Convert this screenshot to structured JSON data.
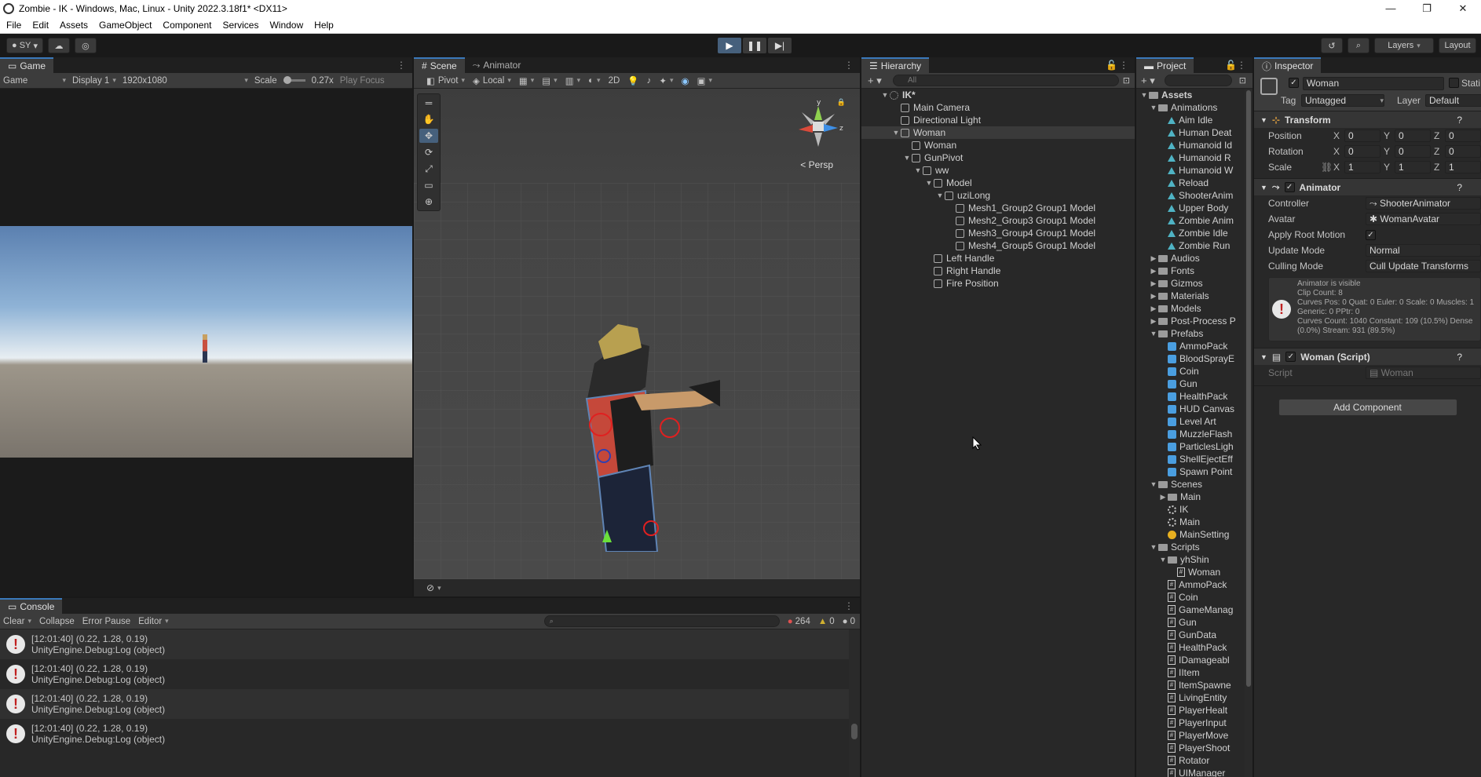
{
  "window": {
    "title": "Zombie - IK - Windows, Mac, Linux - Unity 2022.3.18f1* <DX11>",
    "minimize": "—",
    "maximize": "❐",
    "close": "✕"
  },
  "menu": [
    "File",
    "Edit",
    "Assets",
    "GameObject",
    "Component",
    "Services",
    "Window",
    "Help"
  ],
  "toolbar": {
    "account": "SY",
    "layers": "Layers",
    "layout": "Layout"
  },
  "game": {
    "tab": "Game",
    "mode": "Game",
    "display": "Display 1",
    "resolution": "1920x1080",
    "scale_label": "Scale",
    "scale_value": "0.27x",
    "play_focus": "Play Focus"
  },
  "scene": {
    "tab_scene": "Scene",
    "tab_animator": "Animator",
    "pivot": "Pivot",
    "local": "Local",
    "mode_2d": "2D",
    "persp": "Persp",
    "axis_y": "y",
    "axis_z": "z"
  },
  "hierarchy": {
    "tab": "Hierarchy",
    "search_placeholder": "All",
    "rows": [
      {
        "label": "IK*",
        "depth": 0,
        "arrow": "▼",
        "kind": "scene"
      },
      {
        "label": "Main Camera",
        "depth": 1,
        "arrow": "",
        "kind": "go"
      },
      {
        "label": "Directional Light",
        "depth": 1,
        "arrow": "",
        "kind": "go"
      },
      {
        "label": "Woman",
        "depth": 1,
        "arrow": "▼",
        "kind": "go",
        "selected": true
      },
      {
        "label": "Woman",
        "depth": 2,
        "arrow": "",
        "kind": "go"
      },
      {
        "label": "GunPivot",
        "depth": 2,
        "arrow": "▼",
        "kind": "go"
      },
      {
        "label": "ww",
        "depth": 3,
        "arrow": "▼",
        "kind": "go"
      },
      {
        "label": "Model",
        "depth": 4,
        "arrow": "▼",
        "kind": "go"
      },
      {
        "label": "uziLong",
        "depth": 5,
        "arrow": "▼",
        "kind": "go"
      },
      {
        "label": "Mesh1_Group2 Group1 Model",
        "depth": 6,
        "arrow": "",
        "kind": "go"
      },
      {
        "label": "Mesh2_Group3 Group1 Model",
        "depth": 6,
        "arrow": "",
        "kind": "go"
      },
      {
        "label": "Mesh3_Group4 Group1 Model",
        "depth": 6,
        "arrow": "",
        "kind": "go"
      },
      {
        "label": "Mesh4_Group5 Group1 Model",
        "depth": 6,
        "arrow": "",
        "kind": "go"
      },
      {
        "label": "Left Handle",
        "depth": 4,
        "arrow": "",
        "kind": "go"
      },
      {
        "label": "Right Handle",
        "depth": 4,
        "arrow": "",
        "kind": "go"
      },
      {
        "label": "Fire Position",
        "depth": 4,
        "arrow": "",
        "kind": "go"
      }
    ]
  },
  "project": {
    "tab": "Project",
    "rows": [
      {
        "label": "Assets",
        "depth": 0,
        "arrow": "▼",
        "kind": "folder",
        "bold": true
      },
      {
        "label": "Animations",
        "depth": 1,
        "arrow": "▼",
        "kind": "folder"
      },
      {
        "label": "Aim Idle",
        "depth": 2,
        "arrow": "",
        "kind": "anim"
      },
      {
        "label": "Human Deat",
        "depth": 2,
        "arrow": "",
        "kind": "anim"
      },
      {
        "label": "Humanoid Id",
        "depth": 2,
        "arrow": "",
        "kind": "anim"
      },
      {
        "label": "Humanoid R",
        "depth": 2,
        "arrow": "",
        "kind": "anim"
      },
      {
        "label": "Humanoid W",
        "depth": 2,
        "arrow": "",
        "kind": "anim"
      },
      {
        "label": "Reload",
        "depth": 2,
        "arrow": "",
        "kind": "anim"
      },
      {
        "label": "ShooterAnim",
        "depth": 2,
        "arrow": "",
        "kind": "anim"
      },
      {
        "label": "Upper Body",
        "depth": 2,
        "arrow": "",
        "kind": "anim"
      },
      {
        "label": "Zombie Anim",
        "depth": 2,
        "arrow": "",
        "kind": "anim"
      },
      {
        "label": "Zombie Idle",
        "depth": 2,
        "arrow": "",
        "kind": "anim"
      },
      {
        "label": "Zombie Run",
        "depth": 2,
        "arrow": "",
        "kind": "anim"
      },
      {
        "label": "Audios",
        "depth": 1,
        "arrow": "▶",
        "kind": "folder"
      },
      {
        "label": "Fonts",
        "depth": 1,
        "arrow": "▶",
        "kind": "folder"
      },
      {
        "label": "Gizmos",
        "depth": 1,
        "arrow": "▶",
        "kind": "folder"
      },
      {
        "label": "Materials",
        "depth": 1,
        "arrow": "▶",
        "kind": "folder"
      },
      {
        "label": "Models",
        "depth": 1,
        "arrow": "▶",
        "kind": "folder"
      },
      {
        "label": "Post-Process P",
        "depth": 1,
        "arrow": "▶",
        "kind": "folder"
      },
      {
        "label": "Prefabs",
        "depth": 1,
        "arrow": "▼",
        "kind": "folder"
      },
      {
        "label": "AmmoPack",
        "depth": 2,
        "arrow": "",
        "kind": "prefab"
      },
      {
        "label": "BloodSprayE",
        "depth": 2,
        "arrow": "",
        "kind": "prefab"
      },
      {
        "label": "Coin",
        "depth": 2,
        "arrow": "",
        "kind": "prefab"
      },
      {
        "label": "Gun",
        "depth": 2,
        "arrow": "",
        "kind": "prefab"
      },
      {
        "label": "HealthPack",
        "depth": 2,
        "arrow": "",
        "kind": "prefab"
      },
      {
        "label": "HUD Canvas",
        "depth": 2,
        "arrow": "",
        "kind": "prefab"
      },
      {
        "label": "Level Art",
        "depth": 2,
        "arrow": "",
        "kind": "prefab"
      },
      {
        "label": "MuzzleFlash",
        "depth": 2,
        "arrow": "",
        "kind": "prefab"
      },
      {
        "label": "ParticlesLigh",
        "depth": 2,
        "arrow": "",
        "kind": "prefab"
      },
      {
        "label": "ShellEjectEff",
        "depth": 2,
        "arrow": "",
        "kind": "prefab"
      },
      {
        "label": "Spawn Point",
        "depth": 2,
        "arrow": "",
        "kind": "prefab"
      },
      {
        "label": "Scenes",
        "depth": 1,
        "arrow": "▼",
        "kind": "folder"
      },
      {
        "label": "Main",
        "depth": 2,
        "arrow": "▶",
        "kind": "folder"
      },
      {
        "label": "IK",
        "depth": 2,
        "arrow": "",
        "kind": "scene"
      },
      {
        "label": "Main",
        "depth": 2,
        "arrow": "",
        "kind": "scene"
      },
      {
        "label": "MainSetting",
        "depth": 2,
        "arrow": "",
        "kind": "setting"
      },
      {
        "label": "Scripts",
        "depth": 1,
        "arrow": "▼",
        "kind": "folder"
      },
      {
        "label": "yhShin",
        "depth": 2,
        "arrow": "▼",
        "kind": "folder"
      },
      {
        "label": "Woman",
        "depth": 3,
        "arrow": "",
        "kind": "script"
      },
      {
        "label": "AmmoPack",
        "depth": 2,
        "arrow": "",
        "kind": "script"
      },
      {
        "label": "Coin",
        "depth": 2,
        "arrow": "",
        "kind": "script"
      },
      {
        "label": "GameManag",
        "depth": 2,
        "arrow": "",
        "kind": "script"
      },
      {
        "label": "Gun",
        "depth": 2,
        "arrow": "",
        "kind": "script"
      },
      {
        "label": "GunData",
        "depth": 2,
        "arrow": "",
        "kind": "script"
      },
      {
        "label": "HealthPack",
        "depth": 2,
        "arrow": "",
        "kind": "script"
      },
      {
        "label": "IDamageabl",
        "depth": 2,
        "arrow": "",
        "kind": "script"
      },
      {
        "label": "IItem",
        "depth": 2,
        "arrow": "",
        "kind": "script"
      },
      {
        "label": "ItemSpawne",
        "depth": 2,
        "arrow": "",
        "kind": "script"
      },
      {
        "label": "LivingEntity",
        "depth": 2,
        "arrow": "",
        "kind": "script"
      },
      {
        "label": "PlayerHealt",
        "depth": 2,
        "arrow": "",
        "kind": "script"
      },
      {
        "label": "PlayerInput",
        "depth": 2,
        "arrow": "",
        "kind": "script"
      },
      {
        "label": "PlayerMove",
        "depth": 2,
        "arrow": "",
        "kind": "script"
      },
      {
        "label": "PlayerShoot",
        "depth": 2,
        "arrow": "",
        "kind": "script"
      },
      {
        "label": "Rotator",
        "depth": 2,
        "arrow": "",
        "kind": "script"
      },
      {
        "label": "UIManager",
        "depth": 2,
        "arrow": "",
        "kind": "script"
      }
    ]
  },
  "inspector": {
    "tab": "Inspector",
    "object_name": "Woman",
    "static_label": "Stati",
    "tag_label": "Tag",
    "tag_value": "Untagged",
    "layer_label": "Layer",
    "layer_value": "Default",
    "transform": {
      "title": "Transform",
      "position_label": "Position",
      "rotation_label": "Rotation",
      "scale_label": "Scale",
      "position": [
        "0",
        "0",
        "0"
      ],
      "rotation": [
        "0",
        "0",
        "0"
      ],
      "scale": [
        "1",
        "1",
        "1"
      ]
    },
    "animator": {
      "title": "Animator",
      "controller_label": "Controller",
      "controller_value": "ShooterAnimator",
      "avatar_label": "Avatar",
      "avatar_value": "WomanAvatar",
      "apply_root_label": "Apply Root Motion",
      "update_mode_label": "Update Mode",
      "update_mode_value": "Normal",
      "culling_mode_label": "Culling Mode",
      "culling_mode_value": "Cull Update Transforms",
      "info": [
        "Animator is visible",
        "Clip Count: 8",
        "Curves Pos: 0 Quat: 0 Euler: 0 Scale: 0 Muscles: 1",
        "Generic: 0 PPtr: 0",
        "Curves Count: 1040 Constant: 109 (10.5%) Dense",
        "(0.0%) Stream: 931 (89.5%)"
      ]
    },
    "script": {
      "title": "Woman (Script)",
      "script_label": "Script",
      "script_value": "Woman"
    },
    "add_component": "Add Component"
  },
  "console": {
    "tab": "Console",
    "clear": "Clear",
    "collapse": "Collapse",
    "error_pause": "Error Pause",
    "editor": "Editor",
    "count_errors": "264",
    "count_warnings": "0",
    "count_info": "0",
    "logs": [
      {
        "line1": "[12:01:40] (0.22, 1.28, 0.19)",
        "line2": "UnityEngine.Debug:Log (object)"
      },
      {
        "line1": "[12:01:40] (0.22, 1.28, 0.19)",
        "line2": "UnityEngine.Debug:Log (object)"
      },
      {
        "line1": "[12:01:40] (0.22, 1.28, 0.19)",
        "line2": "UnityEngine.Debug:Log (object)"
      },
      {
        "line1": "[12:01:40] (0.22, 1.28, 0.19)",
        "line2": "UnityEngine.Debug:Log (object)"
      }
    ]
  },
  "colors": {
    "accent": "#3a79bb",
    "play_active": "#46607c",
    "error_red": "#c02020"
  }
}
